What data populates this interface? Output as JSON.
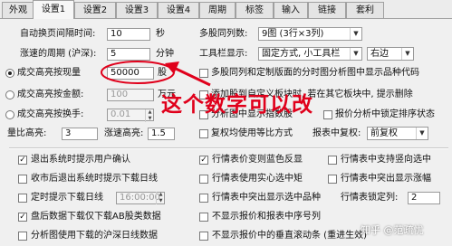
{
  "tabs": [
    "外观",
    "设置1",
    "设置2",
    "设置3",
    "设置4",
    "周期",
    "标签",
    "输入",
    "链接",
    "套利"
  ],
  "top": {
    "auto_refresh_label": "自动换页间隔时间:",
    "auto_refresh_value": "10",
    "auto_refresh_unit": "秒",
    "multi_period_label": "多股同列数:",
    "multi_period_value": "9图 (3行×3列)",
    "period_label": "涨速的周期 (沪深):",
    "period_value": "5",
    "period_unit": "分钟",
    "toolbar_label": "工具栏显示:",
    "toolbar_value": "固定方式, 小工具栏",
    "toolbar_pos": "右边",
    "vol_label": "成交高亮按现量",
    "vol_value": "50000",
    "vol_unit": "股",
    "amt_label": "成交高亮按金额:",
    "amt_value": "100",
    "amt_unit": "万元",
    "turnover_label": "成交高亮按换手:",
    "turnover_value": "0.01",
    "ratio_label": "量比高亮:",
    "ratio_value": "3",
    "speed_label": "涨速高亮:",
    "speed_value": "1.5"
  },
  "right": {
    "opt1": "多股同列和定制版面的分时图分析图中显示品种代码",
    "opt2": "添加股到自定义板块时, 若在其它板块中, 提示删除",
    "opt3": "分析图中显示指数股",
    "opt4": "报价分析中锁定排序状态",
    "opt5": "复权均使用等比方式",
    "report_label": "报表中复权:",
    "report_value": "前复权"
  },
  "bottom_left": [
    {
      "label": "退出系统时提示用户确认",
      "checked": true
    },
    {
      "label": "收市后退出系统时提示下载日线",
      "checked": false
    },
    {
      "label": "定时提示下载日线",
      "checked": false,
      "time": "16:00:00"
    },
    {
      "label": "盘后数据下载仅下载AB股类数据",
      "checked": true
    },
    {
      "label": "分析图使用下载的沪深日线数据",
      "checked": false
    }
  ],
  "bottom_mid": [
    {
      "label": "行情表价变则蓝色反显",
      "checked": true
    },
    {
      "label": "行情表使用实心选中矩",
      "checked": false
    },
    {
      "label": "行情表中突出显示选中品种",
      "checked": false
    },
    {
      "label": "不显示报价和报表中序号列",
      "checked": false
    },
    {
      "label": "不显示报价中的垂直滚动条 (重进生效)",
      "checked": false
    }
  ],
  "bottom_right": [
    {
      "label": "行情表中支持竖向选中",
      "checked": false
    },
    {
      "label": "行情表中突出显示涨幅",
      "checked": false
    },
    {
      "label": "行情表锁定列:",
      "value": "2"
    }
  ],
  "annotation": "这个数字可以改",
  "watermark": "知乎 @范疏忧",
  "colors": {
    "annotation": "#e0001b"
  }
}
